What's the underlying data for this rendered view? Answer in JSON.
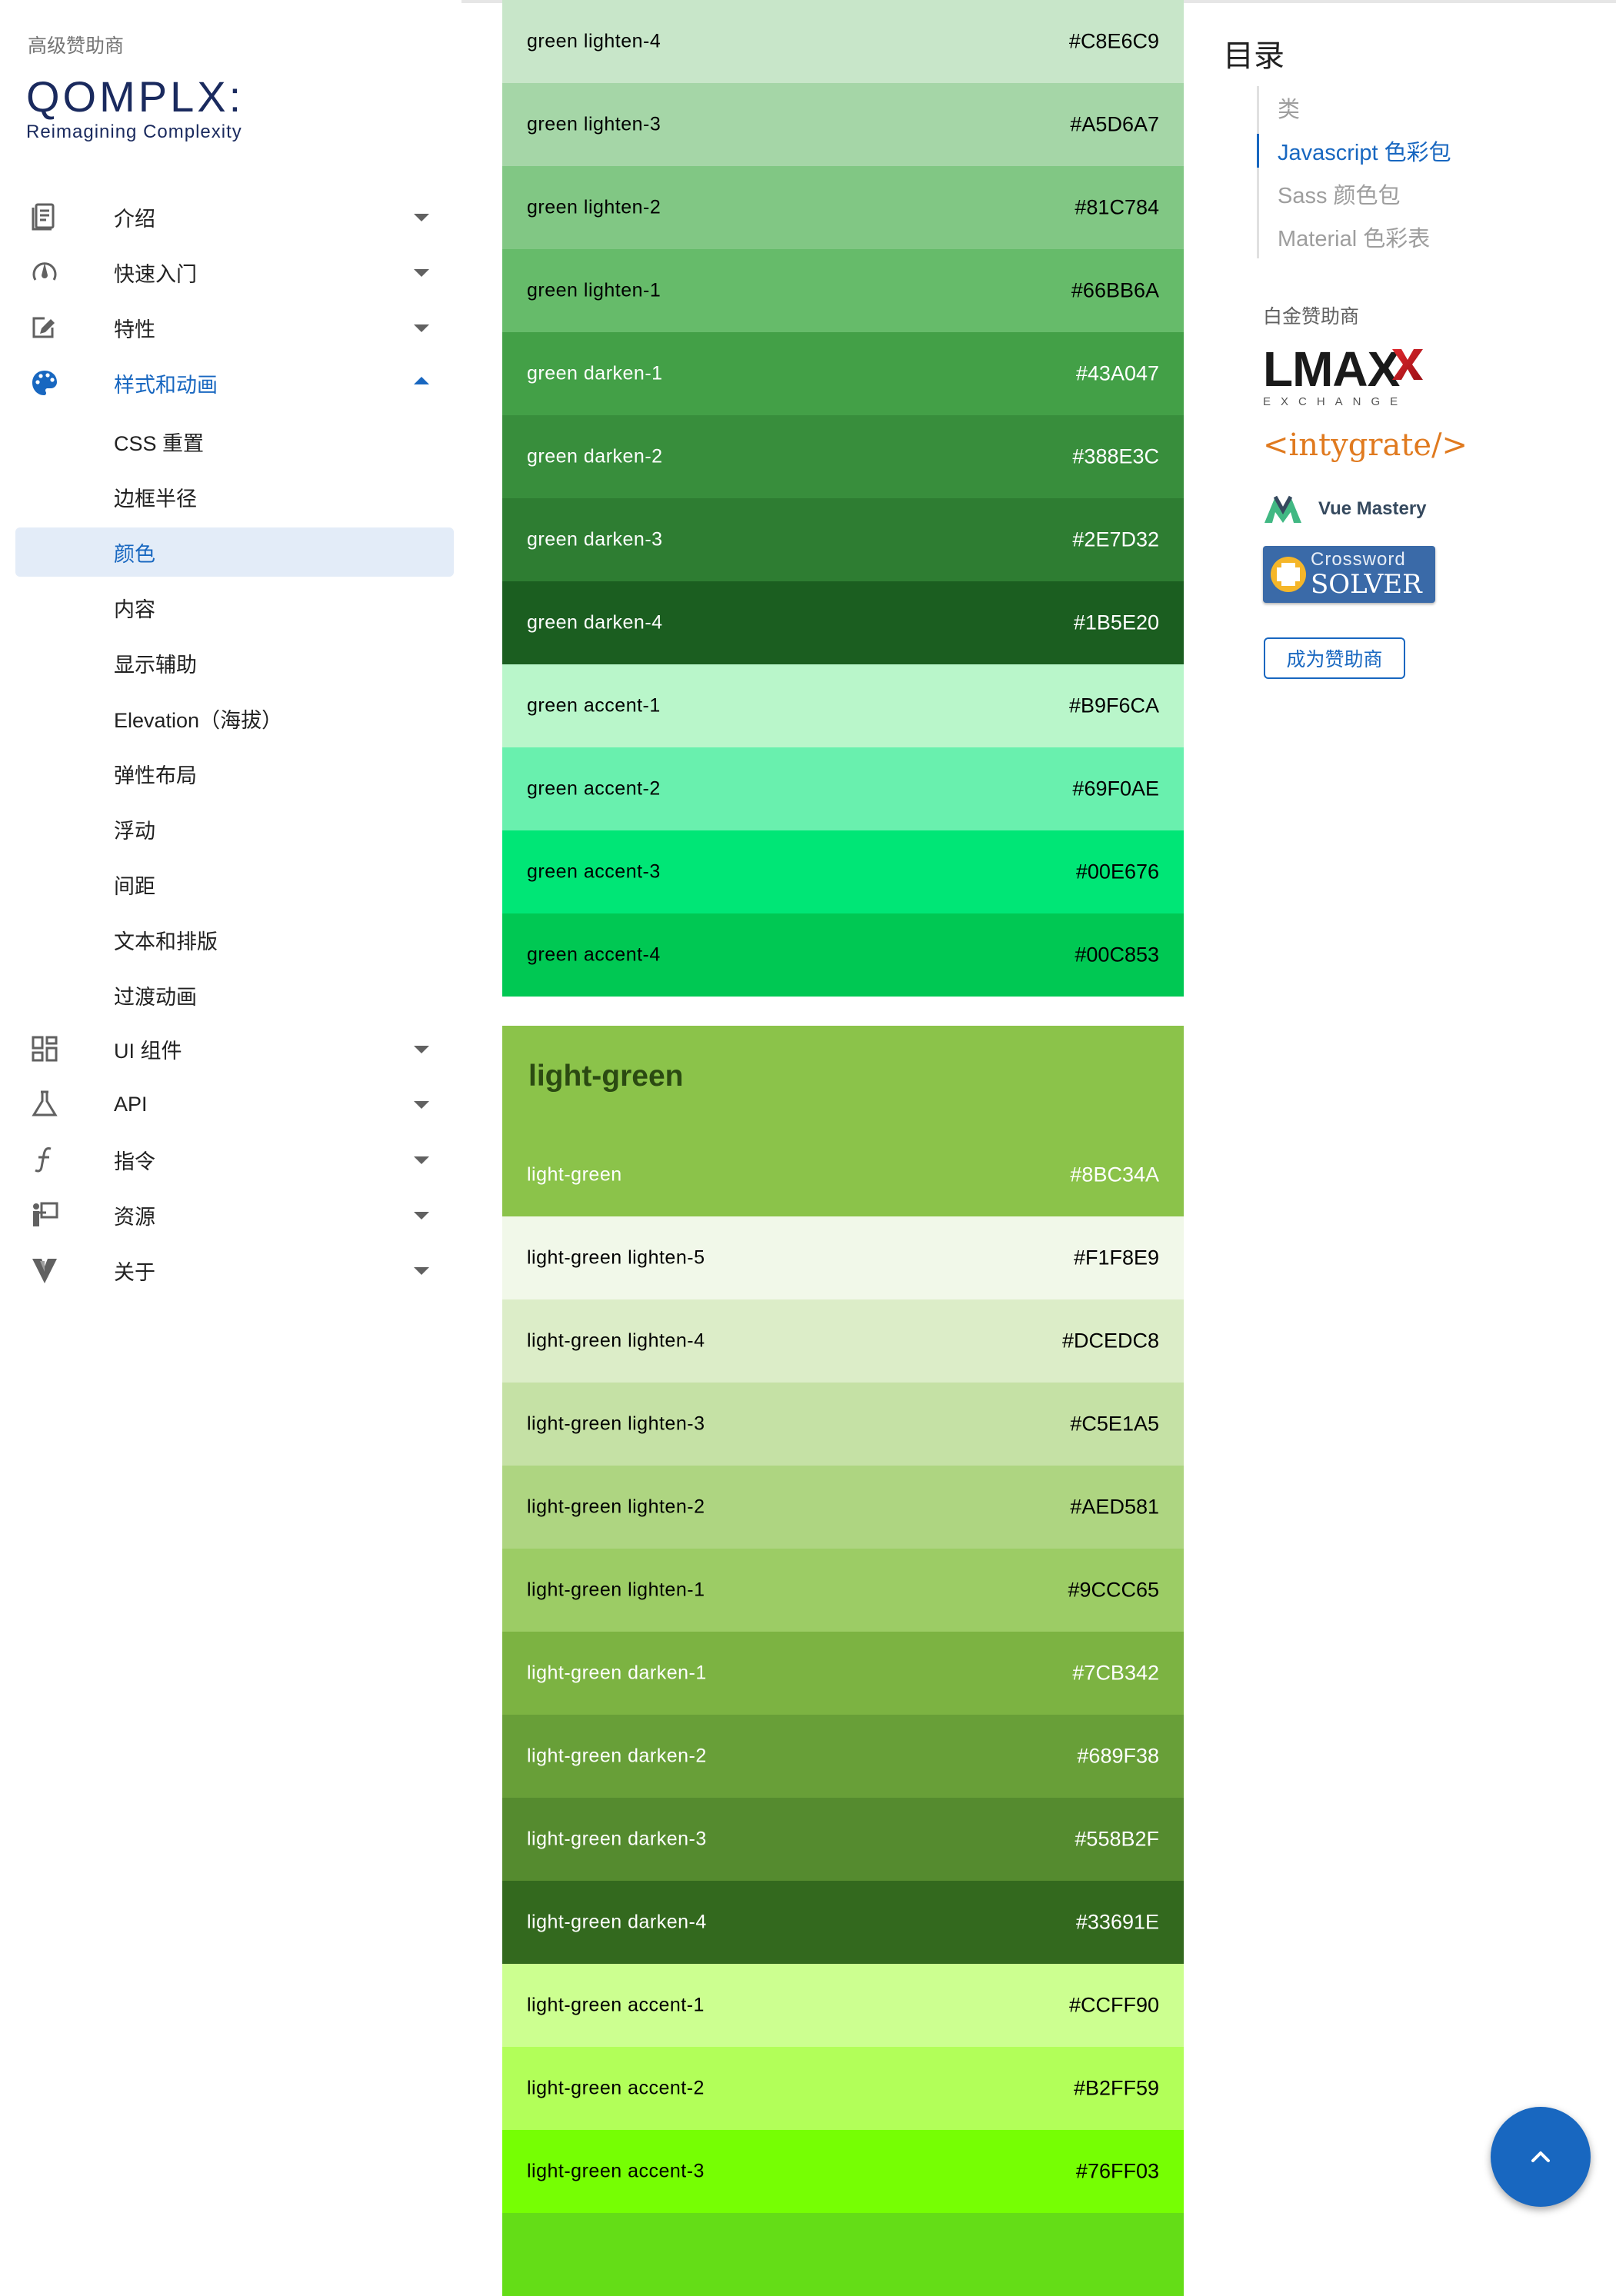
{
  "sidebar": {
    "sponsor_label": "高级赞助商",
    "logo": {
      "word": "QOMPLX:",
      "tagline": "Reimagining Complexity"
    },
    "nav": [
      {
        "label": "介绍",
        "icon": "book-icon"
      },
      {
        "label": "快速入门",
        "icon": "speed-icon"
      },
      {
        "label": "特性",
        "icon": "edit-icon"
      },
      {
        "label": "样式和动画",
        "icon": "palette-icon"
      },
      {
        "label": "UI 组件",
        "icon": "dashboard-icon"
      },
      {
        "label": "API",
        "icon": "flask-icon"
      },
      {
        "label": "指令",
        "icon": "function-icon"
      },
      {
        "label": "资源",
        "icon": "presenter-icon"
      },
      {
        "label": "关于",
        "icon": "vuetify-icon"
      }
    ],
    "sub_items": [
      "CSS 重置",
      "边框半径",
      "颜色",
      "内容",
      "显示辅助",
      "Elevation（海拔）",
      "弹性布局",
      "浮动",
      "间距",
      "文本和排版",
      "过渡动画"
    ]
  },
  "green_swatches": [
    {
      "name": "green lighten-4",
      "hex": "#C8E6C9",
      "fg": "#000000"
    },
    {
      "name": "green lighten-3",
      "hex": "#A5D6A7",
      "fg": "#000000"
    },
    {
      "name": "green lighten-2",
      "hex": "#81C784",
      "fg": "#000000"
    },
    {
      "name": "green lighten-1",
      "hex": "#66BB6A",
      "fg": "#000000"
    },
    {
      "name": "green darken-1",
      "hex": "#43A047",
      "fg": "#ffffff"
    },
    {
      "name": "green darken-2",
      "hex": "#388E3C",
      "fg": "#ffffff"
    },
    {
      "name": "green darken-3",
      "hex": "#2E7D32",
      "fg": "#ffffff"
    },
    {
      "name": "green darken-4",
      "hex": "#1B5E20",
      "fg": "#ffffff"
    },
    {
      "name": "green accent-1",
      "hex": "#B9F6CA",
      "fg": "#000000"
    },
    {
      "name": "green accent-2",
      "hex": "#69F0AE",
      "fg": "#000000"
    },
    {
      "name": "green accent-3",
      "hex": "#00E676",
      "fg": "#000000"
    },
    {
      "name": "green accent-4",
      "hex": "#00C853",
      "fg": "#000000"
    }
  ],
  "light_green": {
    "title": "light-green",
    "base_color": "#8BC34A",
    "swatches": [
      {
        "name": "light-green",
        "hex": "#8BC34A",
        "fg": "#ffffff"
      },
      {
        "name": "light-green lighten-5",
        "hex": "#F1F8E9",
        "fg": "#000000"
      },
      {
        "name": "light-green lighten-4",
        "hex": "#DCEDC8",
        "fg": "#000000"
      },
      {
        "name": "light-green lighten-3",
        "hex": "#C5E1A5",
        "fg": "#000000"
      },
      {
        "name": "light-green lighten-2",
        "hex": "#AED581",
        "fg": "#000000"
      },
      {
        "name": "light-green lighten-1",
        "hex": "#9CCC65",
        "fg": "#000000"
      },
      {
        "name": "light-green darken-1",
        "hex": "#7CB342",
        "fg": "#ffffff"
      },
      {
        "name": "light-green darken-2",
        "hex": "#689F38",
        "fg": "#ffffff"
      },
      {
        "name": "light-green darken-3",
        "hex": "#558B2F",
        "fg": "#ffffff"
      },
      {
        "name": "light-green darken-4",
        "hex": "#33691E",
        "fg": "#ffffff"
      },
      {
        "name": "light-green accent-1",
        "hex": "#CCFF90",
        "fg": "#000000"
      },
      {
        "name": "light-green accent-2",
        "hex": "#B2FF59",
        "fg": "#000000"
      },
      {
        "name": "light-green accent-3",
        "hex": "#76FF03",
        "fg": "#000000"
      },
      {
        "name": "",
        "hex": "",
        "fg": "#000000",
        "bg": "#64DD17"
      }
    ]
  },
  "toc": {
    "title": "目录",
    "items": [
      {
        "label": "类",
        "active": false
      },
      {
        "label": "Javascript 色彩包",
        "active": true
      },
      {
        "label": "Sass 颜色包",
        "active": false
      },
      {
        "label": "Material 色彩表",
        "active": false
      }
    ],
    "platinum_label": "白金赞助商",
    "sponsors": {
      "lmax_word": "LMAX",
      "lmax_sub": "EXCHANGE",
      "intygrate": "<intygrate/>",
      "vue_mastery": "Vue Mastery",
      "crossword_top": "Crossword",
      "crossword_bottom": "SOLVER"
    },
    "become_sponsor": "成为赞助商"
  },
  "colors": {
    "accent": "#1867c0",
    "active_bg": "#e3ecf8"
  }
}
